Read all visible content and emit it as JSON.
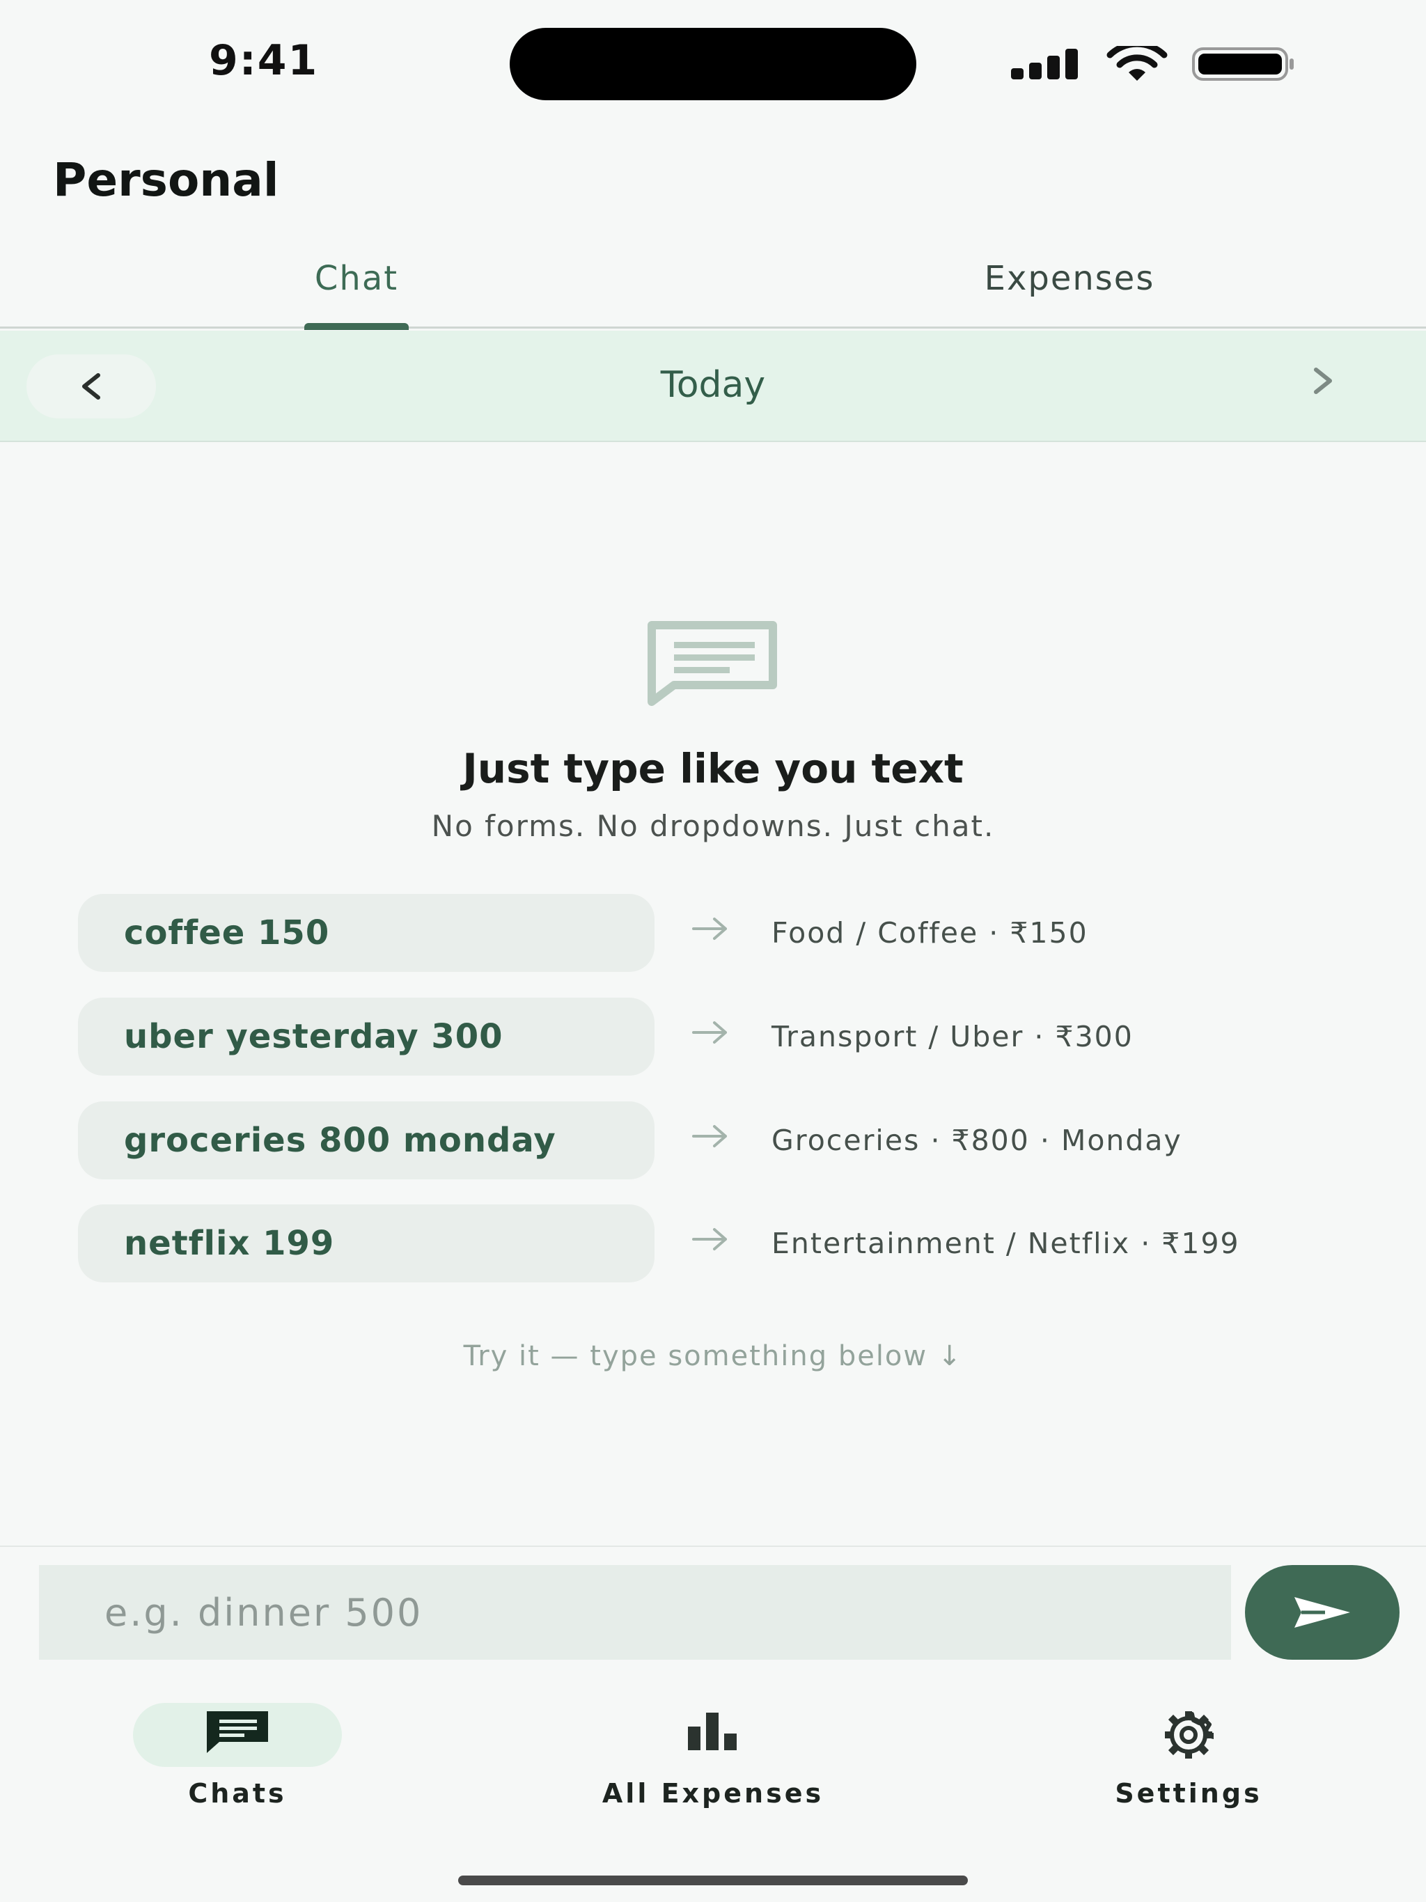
{
  "status_bar": {
    "time": "9:41"
  },
  "header": {
    "title": "Personal"
  },
  "tabs": [
    {
      "label": "Chat",
      "active": true
    },
    {
      "label": "Expenses",
      "active": false
    }
  ],
  "date_nav": {
    "label": "Today",
    "prev_icon": "chevron-left-icon",
    "next_icon": "chevron-right-icon"
  },
  "empty_state": {
    "icon": "message-icon",
    "title": "Just type like you text",
    "subtitle": "No forms. No dropdowns. Just chat.",
    "examples": [
      {
        "input": "coffee 150",
        "result": "Food / Coffee · ₹150"
      },
      {
        "input": "uber yesterday 300",
        "result": "Transport / Uber · ₹300"
      },
      {
        "input": "groceries 800 monday",
        "result": "Groceries · ₹800 · Monday"
      },
      {
        "input": "netflix 199",
        "result": "Entertainment / Netflix · ₹199"
      }
    ],
    "hint": "Try it — type something below ↓"
  },
  "composer": {
    "placeholder": "e.g. dinner 500",
    "value": "",
    "send_icon": "send-icon"
  },
  "bottom_nav": [
    {
      "label": "Chats",
      "icon": "chat-icon",
      "active": true
    },
    {
      "label": "All Expenses",
      "icon": "bar-chart-icon",
      "active": false
    },
    {
      "label": "Settings",
      "icon": "gear-icon",
      "active": false
    }
  ],
  "colors": {
    "accent": "#3f6a55",
    "background": "#f6f8f7",
    "date_bar": "#e4f3ea",
    "chip": "#e9eeeb"
  }
}
